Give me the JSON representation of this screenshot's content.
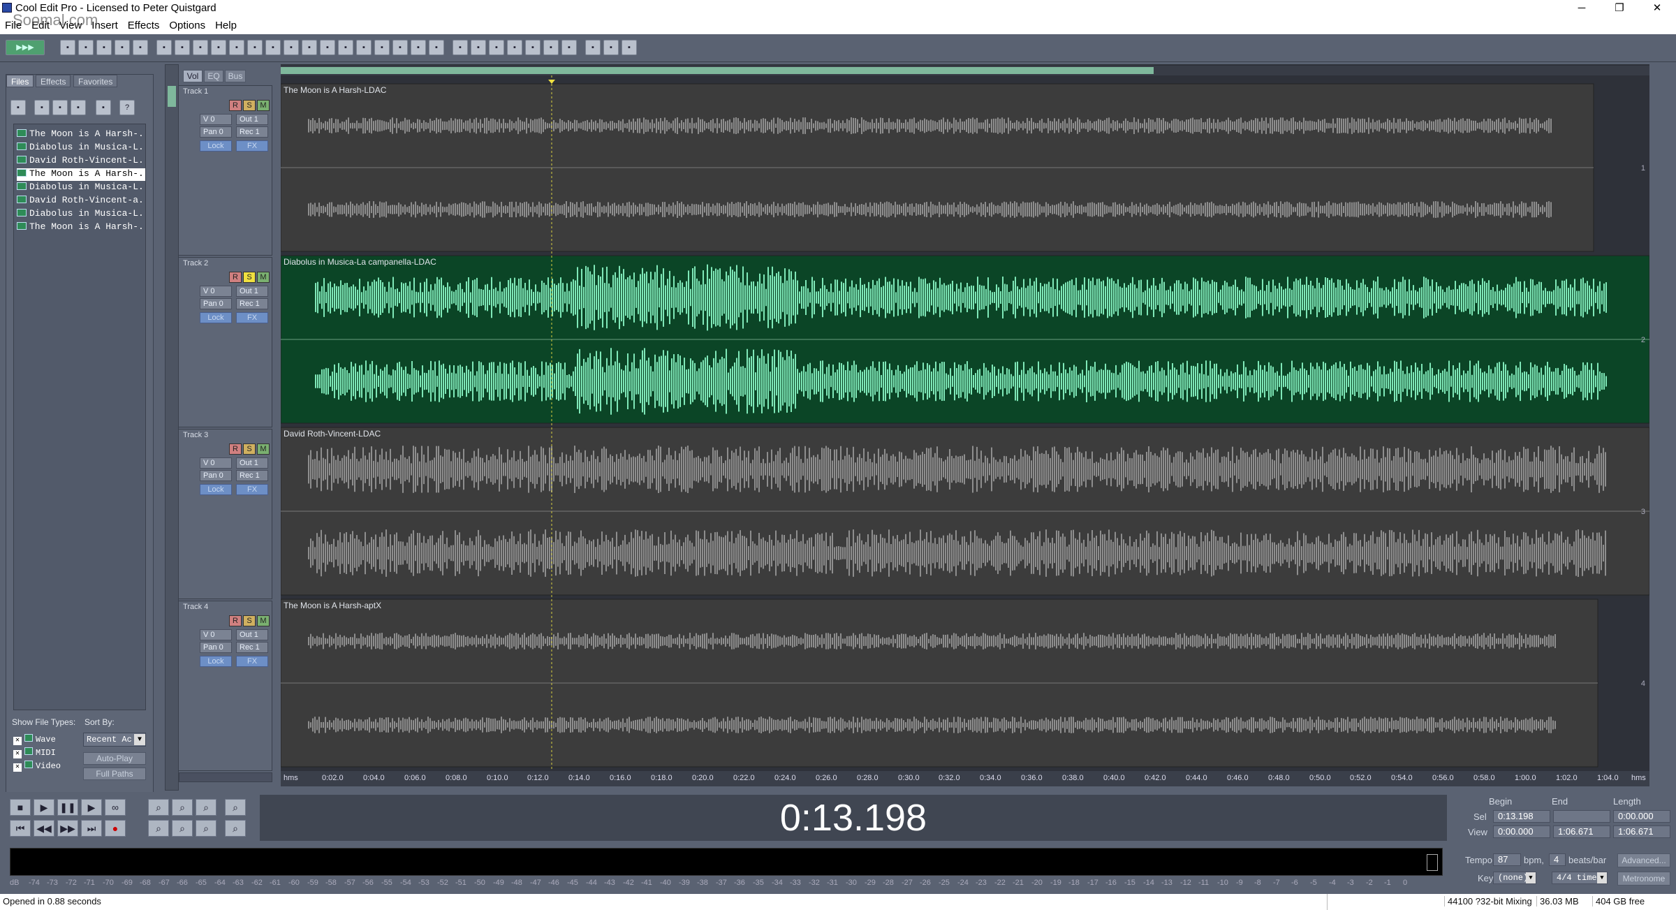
{
  "window": {
    "title": "Cool Edit Pro  - Licensed to Peter Quistgard",
    "watermark": "Soomal.com"
  },
  "menu": [
    "File",
    "Edit",
    "View",
    "Insert",
    "Effects",
    "Options",
    "Help"
  ],
  "left_panel": {
    "tabs": [
      "Files",
      "Effects",
      "Favorites"
    ],
    "files": [
      "The Moon is A Harsh-...",
      "Diabolus in Musica-L...",
      "David Roth-Vincent-L...",
      "The Moon is A Harsh-...",
      "Diabolus in Musica-L...",
      "David Roth-Vincent-a...",
      "Diabolus in Musica-L...",
      "The Moon is A Harsh-..."
    ],
    "show_file_types": "Show File Types:",
    "sort_by": "Sort By:",
    "types": [
      "Wave",
      "MIDI",
      "Video"
    ],
    "sort_value": "Recent Ac",
    "auto_play": "Auto-Play",
    "full_paths": "Full Paths"
  },
  "header_tabs": [
    "Vol",
    "EQ",
    "Bus"
  ],
  "tracks": [
    {
      "name": "Track 1",
      "clip": "The Moon is A Harsh-LDAC",
      "vol": "V 0",
      "pan": "Pan 0",
      "out": "Out 1",
      "rec": "Rec 1",
      "lock": "Lock",
      "fx": "FX",
      "num": "1"
    },
    {
      "name": "Track 2",
      "clip": "Diabolus in Musica-La campanella-LDAC",
      "vol": "V 0",
      "pan": "Pan 0",
      "out": "Out 1",
      "rec": "Rec 1",
      "lock": "Lock",
      "fx": "FX",
      "num": "2"
    },
    {
      "name": "Track 3",
      "clip": "David Roth-Vincent-LDAC",
      "vol": "V 0",
      "pan": "Pan 0",
      "out": "Out 1",
      "rec": "Rec 1",
      "lock": "Lock",
      "fx": "FX",
      "num": "3"
    },
    {
      "name": "Track 4",
      "clip": "The Moon is A Harsh-aptX",
      "vol": "V 0",
      "pan": "Pan 0",
      "out": "Out 1",
      "rec": "Rec 1",
      "lock": "Lock",
      "fx": "FX",
      "num": "4"
    }
  ],
  "track_buttons": [
    "R",
    "S",
    "M"
  ],
  "ruler": [
    "hms",
    "0:02.0",
    "0:04.0",
    "0:06.0",
    "0:08.0",
    "0:10.0",
    "0:12.0",
    "0:14.0",
    "0:16.0",
    "0:18.0",
    "0:20.0",
    "0:22.0",
    "0:24.0",
    "0:26.0",
    "0:28.0",
    "0:30.0",
    "0:32.0",
    "0:34.0",
    "0:36.0",
    "0:38.0",
    "0:40.0",
    "0:42.0",
    "0:44.0",
    "0:46.0",
    "0:48.0",
    "0:50.0",
    "0:52.0",
    "0:54.0",
    "0:56.0",
    "0:58.0",
    "1:00.0",
    "1:02.0",
    "1:04.0",
    "hms"
  ],
  "time_display": "0:13.198",
  "meter_scale": [
    "dB",
    "-74",
    "-73",
    "-72",
    "-71",
    "-70",
    "-69",
    "-68",
    "-67",
    "-66",
    "-65",
    "-64",
    "-63",
    "-62",
    "-61",
    "-60",
    "-59",
    "-58",
    "-57",
    "-56",
    "-55",
    "-54",
    "-53",
    "-52",
    "-51",
    "-50",
    "-49",
    "-48",
    "-47",
    "-46",
    "-45",
    "-44",
    "-43",
    "-42",
    "-41",
    "-40",
    "-39",
    "-38",
    "-37",
    "-36",
    "-35",
    "-34",
    "-33",
    "-32",
    "-31",
    "-30",
    "-29",
    "-28",
    "-27",
    "-26",
    "-25",
    "-24",
    "-23",
    "-22",
    "-21",
    "-20",
    "-19",
    "-18",
    "-17",
    "-16",
    "-15",
    "-14",
    "-13",
    "-12",
    "-11",
    "-10",
    "-9",
    "-8",
    "-7",
    "-6",
    "-5",
    "-4",
    "-3",
    "-2",
    "-1",
    "0"
  ],
  "selection": {
    "begin_label": "Begin",
    "end_label": "End",
    "length_label": "Length",
    "sel_label": "Sel",
    "view_label": "View",
    "sel_begin": "0:13.198",
    "sel_end": "",
    "sel_length": "0:00.000",
    "view_begin": "0:00.000",
    "view_end": "1:06.671",
    "view_length": "1:06.671"
  },
  "tempo": {
    "tempo_label": "Tempo",
    "tempo": "87",
    "bpm": "bpm,",
    "beats": "4",
    "beats_label": "beats/bar",
    "advanced": "Advanced...",
    "key_label": "Key",
    "key": "(none)",
    "time_sig": "4/4 time",
    "metronome": "Metronome"
  },
  "status": {
    "left": "Opened in 0.88 seconds",
    "rate": "44100 ?32-bit Mixing",
    "mem": "36.03 MB",
    "free": "404 GB free"
  },
  "playhead_fraction": 0.198,
  "colors": {
    "track2_bg": "#0b4526",
    "track2_wave": "#7fe8b8",
    "wave_gray": "#8e8e8e"
  }
}
